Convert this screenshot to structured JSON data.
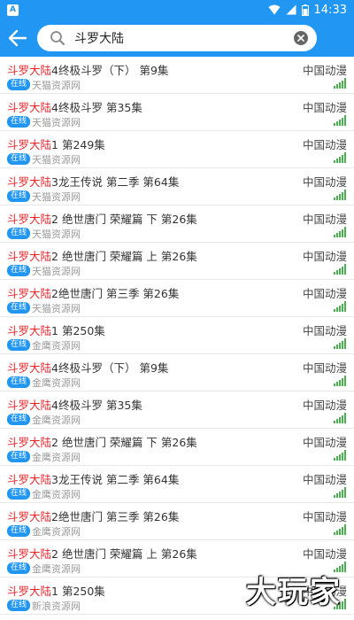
{
  "status_bar": {
    "notif_icon": "A",
    "time": "14:33"
  },
  "search": {
    "query": "斗罗大陆"
  },
  "results": [
    {
      "keyword": "斗罗大陆",
      "rest": "4终极斗罗（下） 第9集",
      "badge": "在线",
      "source": "天猫资源网",
      "category": "中国动漫"
    },
    {
      "keyword": "斗罗大陆",
      "rest": "4终极斗罗 第35集",
      "badge": "在线",
      "source": "天猫资源网",
      "category": "中国动漫"
    },
    {
      "keyword": "斗罗大陆",
      "rest": "1 第249集",
      "badge": "在线",
      "source": "天猫资源网",
      "category": "中国动漫"
    },
    {
      "keyword": "斗罗大陆",
      "rest": "3龙王传说 第二季 第64集",
      "badge": "在线",
      "source": "天猫资源网",
      "category": "中国动漫"
    },
    {
      "keyword": "斗罗大陆",
      "rest": "2 绝世唐门 荣耀篇 下 第26集",
      "badge": "在线",
      "source": "天猫资源网",
      "category": "中国动漫"
    },
    {
      "keyword": "斗罗大陆",
      "rest": "2 绝世唐门 荣耀篇 上 第26集",
      "badge": "在线",
      "source": "天猫资源网",
      "category": "中国动漫"
    },
    {
      "keyword": "斗罗大陆",
      "rest": "2绝世唐门 第三季 第26集",
      "badge": "在线",
      "source": "天猫资源网",
      "category": "中国动漫"
    },
    {
      "keyword": "斗罗大陆",
      "rest": "1 第250集",
      "badge": "在线",
      "source": "金鹰资源网",
      "category": "中国动漫"
    },
    {
      "keyword": "斗罗大陆",
      "rest": "4终极斗罗（下） 第9集",
      "badge": "在线",
      "source": "金鹰资源网",
      "category": "中国动漫"
    },
    {
      "keyword": "斗罗大陆",
      "rest": "4终极斗罗 第35集",
      "badge": "在线",
      "source": "金鹰资源网",
      "category": "中国动漫"
    },
    {
      "keyword": "斗罗大陆",
      "rest": "2 绝世唐门 荣耀篇 下 第26集",
      "badge": "在线",
      "source": "金鹰资源网",
      "category": "中国动漫"
    },
    {
      "keyword": "斗罗大陆",
      "rest": "3龙王传说 第二季 第64集",
      "badge": "在线",
      "source": "金鹰资源网",
      "category": "中国动漫"
    },
    {
      "keyword": "斗罗大陆",
      "rest": "2绝世唐门 第三季 第26集",
      "badge": "在线",
      "source": "金鹰资源网",
      "category": "中国动漫"
    },
    {
      "keyword": "斗罗大陆",
      "rest": "2 绝世唐门 荣耀篇 上 第26集",
      "badge": "在线",
      "source": "金鹰资源网",
      "category": "中国动漫"
    },
    {
      "keyword": "斗罗大陆",
      "rest": "1 第250集",
      "badge": "在线",
      "source": "新浪资源网",
      "category": "中国动漫"
    }
  ],
  "watermark": "大玩家",
  "colors": {
    "primary": "#2196f3",
    "keyword": "#e8272b",
    "signal": "#4caf50"
  }
}
